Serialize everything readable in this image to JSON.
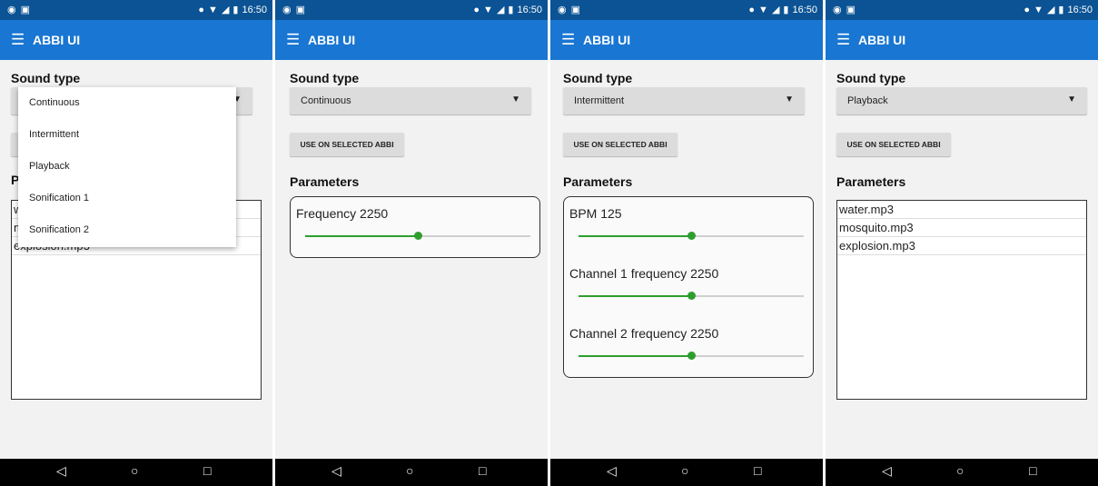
{
  "status_bar": {
    "time": "16:50"
  },
  "app": {
    "title": "ABBI UI",
    "menu_icon": "hamburger-icon"
  },
  "labels": {
    "sound_type": "Sound type",
    "parameters": "Parameters",
    "use_button": "USE ON SELECTED ABBI"
  },
  "dropdown_options": [
    "Continuous",
    "Intermittent",
    "Playback",
    "Sonification 1",
    "Sonification 2"
  ],
  "screens": [
    {
      "selected": "",
      "dropdown_open": true,
      "partial_rows": [
        "w",
        "m",
        "explosion.mp3"
      ],
      "partial_param_letter": "P"
    },
    {
      "selected": "Continuous",
      "params": [
        {
          "label": "Frequency 2250",
          "value_fraction": 0.5
        }
      ]
    },
    {
      "selected": "Intermittent",
      "params": [
        {
          "label": "BPM 125",
          "value_fraction": 0.5
        },
        {
          "label": "Channel 1 frequency 2250",
          "value_fraction": 0.5
        },
        {
          "label": "Channel 2 frequency 2250",
          "value_fraction": 0.5
        }
      ]
    },
    {
      "selected": "Playback",
      "files": [
        "water.mp3",
        "mosquito.mp3",
        "explosion.mp3"
      ]
    }
  ],
  "nav": {
    "back_icon": "back-triangle-icon",
    "home_icon": "home-circle-icon",
    "recent_icon": "recent-square-icon"
  }
}
